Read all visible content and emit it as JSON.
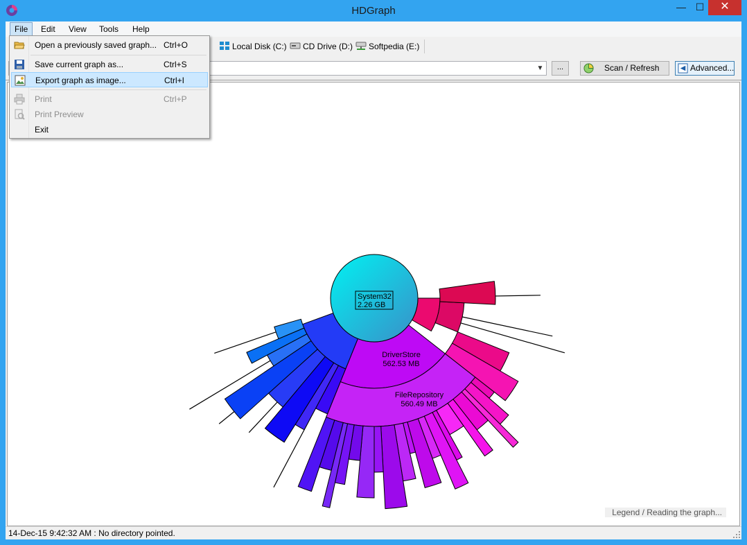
{
  "window": {
    "title": "HDGraph",
    "min_glyph": "—",
    "max_glyph": "☐",
    "close_glyph": "✕"
  },
  "menubar": {
    "items": [
      "File",
      "Edit",
      "View",
      "Tools",
      "Help"
    ]
  },
  "drives": {
    "partial_label": "s:",
    "items": [
      {
        "label": "Local Disk (C:)",
        "icon": "hard-disk-icon"
      },
      {
        "label": "CD Drive (D:)",
        "icon": "cd-drive-icon"
      },
      {
        "label": "Softpedia (E:)",
        "icon": "network-drive-icon"
      }
    ]
  },
  "path_bar": {
    "value": "",
    "browse_label": "...",
    "scan_label": "Scan / Refresh",
    "advanced_label": "Advanced..."
  },
  "file_menu": {
    "items": [
      {
        "label": "Open a previously saved graph...",
        "shortcut": "Ctrl+O",
        "icon": "open-folder-icon",
        "enabled": true
      },
      {
        "label": "Save current graph as...",
        "shortcut": "Ctrl+S",
        "icon": "save-disk-icon",
        "enabled": true
      },
      {
        "label": "Export graph as image...",
        "shortcut": "Ctrl+I",
        "icon": "export-image-icon",
        "enabled": true,
        "highlighted": true
      },
      {
        "label": "Print",
        "shortcut": "Ctrl+P",
        "icon": "printer-icon",
        "enabled": false
      },
      {
        "label": "Print Preview",
        "shortcut": "",
        "icon": "print-preview-icon",
        "enabled": false
      },
      {
        "label": "Exit",
        "shortcut": "",
        "icon": "",
        "enabled": true
      }
    ]
  },
  "graph": {
    "center": {
      "name": "System32",
      "size": "2.26 GB"
    },
    "labels": [
      {
        "name": "DriverStore",
        "size": "562.53 MB"
      },
      {
        "name": "FileRepository",
        "size": "560.49 MB"
      }
    ]
  },
  "legend_link": "Legend / Reading the graph...",
  "status": {
    "text": "14-Dec-15 9:42:32 AM : No directory pointed."
  },
  "colors": {
    "titlebar": "#33a4f0",
    "close": "#c7312e",
    "highlight": "#cce8ff"
  }
}
